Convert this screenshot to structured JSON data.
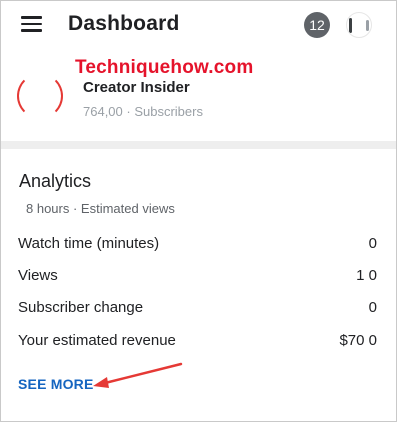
{
  "header": {
    "menu_icon": "hamburger-menu-icon",
    "title": "Dashboard",
    "notifications_count": "12",
    "avatar_icon": "account-avatar"
  },
  "watermark": "Techniquehow.com",
  "channel": {
    "name": "Creator Insider",
    "subscribers": "764,00 · Subscribers"
  },
  "analytics": {
    "title": "Analytics",
    "subtitle": "8 hours · Estimated views",
    "metrics": [
      {
        "label": "Watch time (minutes)",
        "value": "0"
      },
      {
        "label": "Views",
        "value": "1 0"
      },
      {
        "label": "Subscriber change",
        "value": "0"
      },
      {
        "label": "Your estimated revenue",
        "value": "$70 0"
      }
    ],
    "see_more": "SEE MORE"
  },
  "colors": {
    "accent_link": "#1565c0",
    "watermark_red": "#e5132b",
    "annotation_arrow": "#e53935",
    "badge_grey": "#5f6368"
  }
}
